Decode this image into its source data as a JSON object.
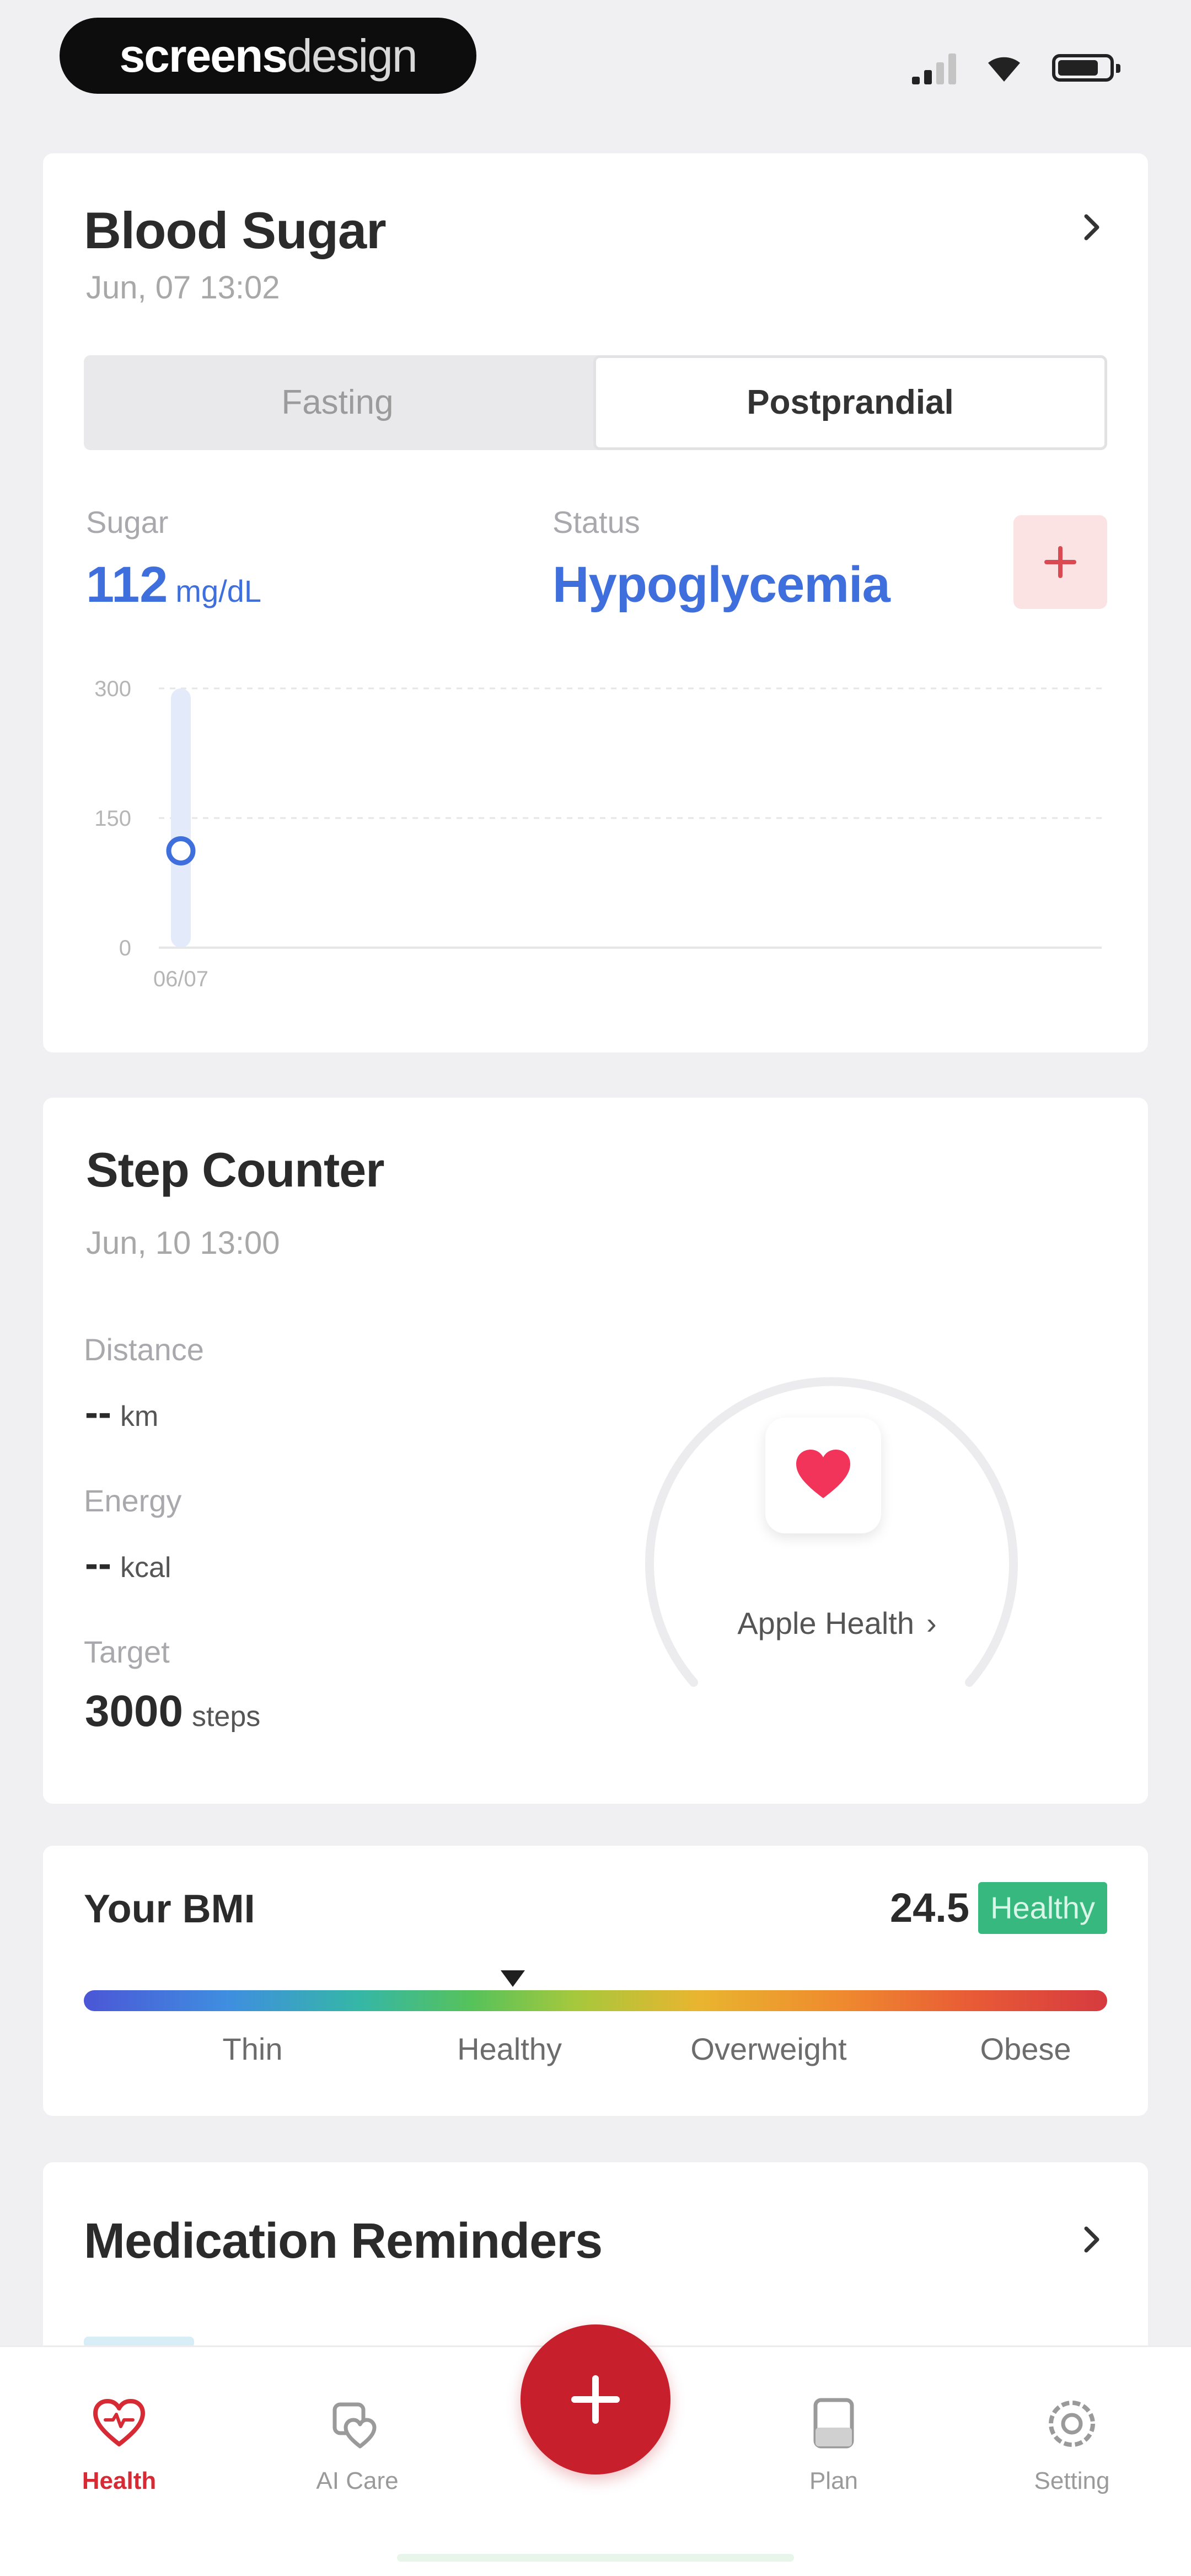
{
  "status_bar": {
    "brand_bold": "screens",
    "brand_light": "design",
    "icons": [
      "signal-icon",
      "wifi-icon",
      "battery-icon"
    ]
  },
  "blood_sugar": {
    "title": "Blood Sugar",
    "timestamp": "Jun, 07 13:02",
    "tabs": [
      "Fasting",
      "Postprandial"
    ],
    "active_tab": "Postprandial",
    "sugar_label": "Sugar",
    "sugar_value": "112",
    "sugar_unit": "mg/dL",
    "status_label": "Status",
    "status_value": "Hypoglycemia",
    "accent_color": "#3f6fdc"
  },
  "chart_data": {
    "type": "scatter",
    "x": [
      "06/07"
    ],
    "values": [
      112
    ],
    "yticks": [
      "300",
      "150",
      "0"
    ],
    "ylim": [
      0,
      300
    ],
    "grid": true,
    "color": "#3f6fdc"
  },
  "step_counter": {
    "title": "Step Counter",
    "timestamp": "Jun, 10 13:00",
    "distance_label": "Distance",
    "distance_value": "--",
    "distance_unit": "km",
    "energy_label": "Energy",
    "energy_value": "--",
    "energy_unit": "kcal",
    "target_label": "Target",
    "target_value": "3000",
    "target_unit": "steps",
    "apple_health": "Apple Health"
  },
  "bmi": {
    "title": "Your BMI",
    "value": "24.5",
    "badge": "Healthy",
    "badge_color": "#36b87f",
    "categories": [
      "Thin",
      "Healthy",
      "Overweight",
      "Obese"
    ]
  },
  "medication": {
    "title": "Medication Reminders"
  },
  "tabbar": {
    "items": [
      {
        "label": "Health",
        "icon": "heart-icon",
        "active": true
      },
      {
        "label": "AI Care",
        "icon": "ai-care-icon",
        "active": false
      },
      {
        "label": "Plan",
        "icon": "plan-icon",
        "active": false
      },
      {
        "label": "Setting",
        "icon": "gear-icon",
        "active": false
      }
    ],
    "fab_icon": "plus-icon",
    "active_color": "#d62b35"
  }
}
